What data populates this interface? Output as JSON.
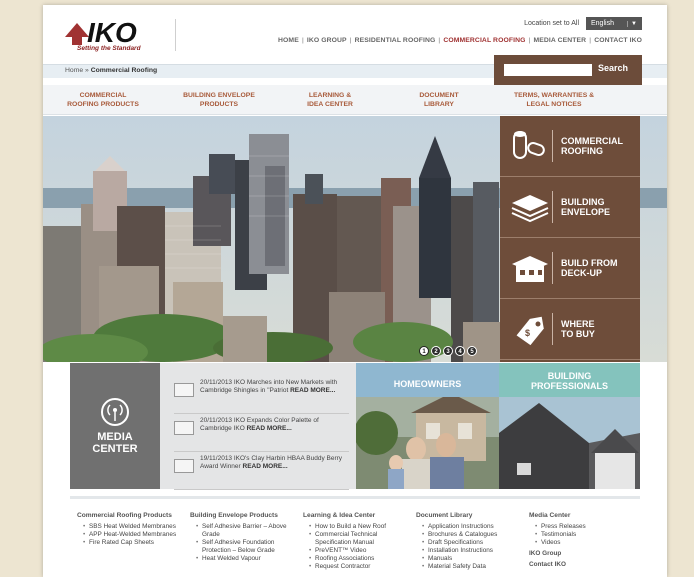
{
  "header": {
    "logo_text": "IKO",
    "tagline": "Setting the Standard",
    "location_text": "Location set to All",
    "language": "English",
    "top_nav": [
      "HOME",
      "IKO GROUP",
      "RESIDENTIAL ROOFING",
      "COMMERCIAL ROOFING",
      "MEDIA CENTER",
      "CONTACT IKO"
    ],
    "top_nav_active": "COMMERCIAL ROOFING"
  },
  "breadcrumb": {
    "home": "Home",
    "separator": " » ",
    "current": "Commercial Roofing"
  },
  "search": {
    "button": "Search",
    "value": ""
  },
  "main_nav": [
    {
      "line1": "COMMERCIAL",
      "line2": "ROOFING PRODUCTS"
    },
    {
      "line1": "BUILDING ENVELOPE",
      "line2": "PRODUCTS"
    },
    {
      "line1": "LEARNING &",
      "line2": "IDEA CENTER"
    },
    {
      "line1": "DOCUMENT",
      "line2": "LIBRARY"
    },
    {
      "line1": "TERMS, WARRANTIES &",
      "line2": "LEGAL NOTICES"
    }
  ],
  "hero": {
    "slides": [
      "1",
      "2",
      "3",
      "4",
      "5"
    ],
    "active_slide": "1"
  },
  "side_menu": [
    {
      "line1": "COMMERCIAL",
      "line2": "ROOFING",
      "icon": "roll-icon"
    },
    {
      "line1": "BUILDING",
      "line2": "ENVELOPE",
      "icon": "panel-stack-icon"
    },
    {
      "line1": "BUILD FROM",
      "line2": "DECK-UP",
      "icon": "building-icon"
    },
    {
      "line1": "WHERE",
      "line2": "TO BUY",
      "icon": "price-tag-icon"
    }
  ],
  "media_center": {
    "title_line1": "MEDIA",
    "title_line2": "CENTER",
    "news": [
      {
        "text": "20/11/2013 IKO Marches into New Markets with Cambridge Shingles in \"Patriot ",
        "more": "READ MORE..."
      },
      {
        "text": "20/11/2013 IKO Expands Color Palette of Cambridge IKO ",
        "more": "READ MORE..."
      },
      {
        "text": "19/11/2013 IKO's Clay Harbin HBAA Buddy Berry Award Winner ",
        "more": "READ MORE..."
      }
    ]
  },
  "panels": {
    "homeowners": "HOMEOWNERS",
    "pros_line1": "BUILDING",
    "pros_line2": "PROFESSIONALS"
  },
  "footer": [
    {
      "heading": "Commercial Roofing Products",
      "items": [
        "SBS Heat Welded Membranes",
        "APP Heat-Welded Membranes",
        "Fire Rated Cap Sheets"
      ]
    },
    {
      "heading": "Building Envelope Products",
      "items": [
        "Self Adhesive Barrier – Above Grade",
        "Self Adhesive Foundation Protection – Below Grade",
        "Heat Welded Vapour"
      ]
    },
    {
      "heading": "Learning & Idea Center",
      "items": [
        "How to Build a New Roof",
        "Commercial Technical Specification Manual",
        "PreVENT™ Video",
        "Roofing Associations",
        "Request Contractor"
      ]
    },
    {
      "heading": "Document Library",
      "items": [
        "Application Instructions",
        "Brochures & Catalogues",
        "Draft Specifications",
        "Installation Instructions",
        "Manuals",
        "Material Safety Data"
      ]
    },
    {
      "heading": "Media Center",
      "items": [
        "Press Releases",
        "Testimonials",
        "Videos"
      ],
      "subheading": "IKO Group",
      "subitems": [
        "Contact IKO"
      ]
    }
  ],
  "colors": {
    "brand_red": "#a03232",
    "brown_menu": "#6e4d3a",
    "nav_text": "#a85a3a",
    "homeowners_band": "#8fb7d0",
    "pros_band": "#84c3bd"
  }
}
